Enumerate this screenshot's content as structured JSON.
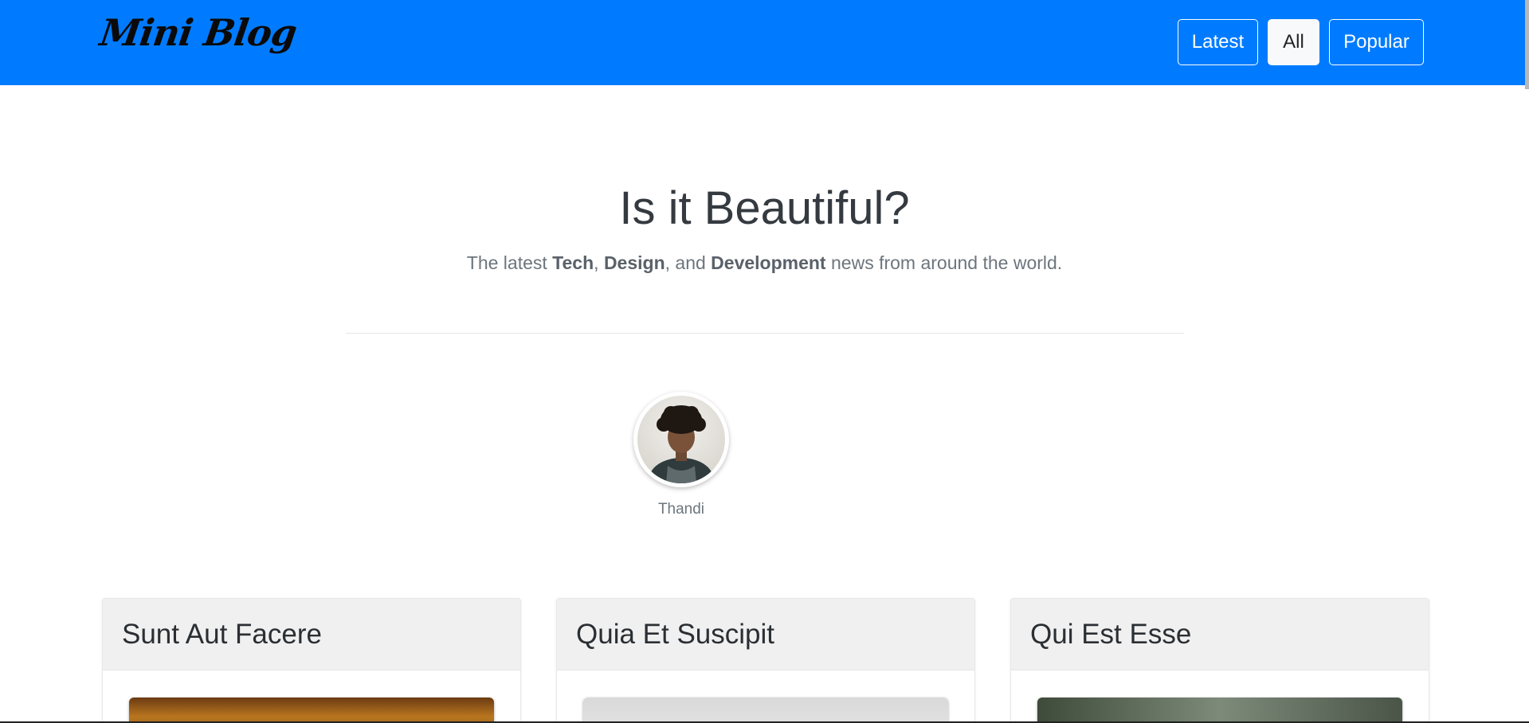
{
  "navbar": {
    "brand": "Mini Blog",
    "buttons": [
      {
        "label": "Latest",
        "active": false
      },
      {
        "label": "All",
        "active": true
      },
      {
        "label": "Popular",
        "active": false
      }
    ],
    "background_color": "#007bff"
  },
  "hero": {
    "title": "Is it Beautiful?",
    "subtitle_parts": {
      "prefix": "The latest ",
      "tech": "Tech",
      "sep1": ", ",
      "design": "Design",
      "sep2": ", and ",
      "development": "Development",
      "suffix": " news from around the world."
    }
  },
  "author": {
    "name": "Thandi"
  },
  "posts": [
    {
      "title": "Sunt Aut Facere"
    },
    {
      "title": "Quia Et Suscipit"
    },
    {
      "title": "Qui Est Esse"
    }
  ]
}
